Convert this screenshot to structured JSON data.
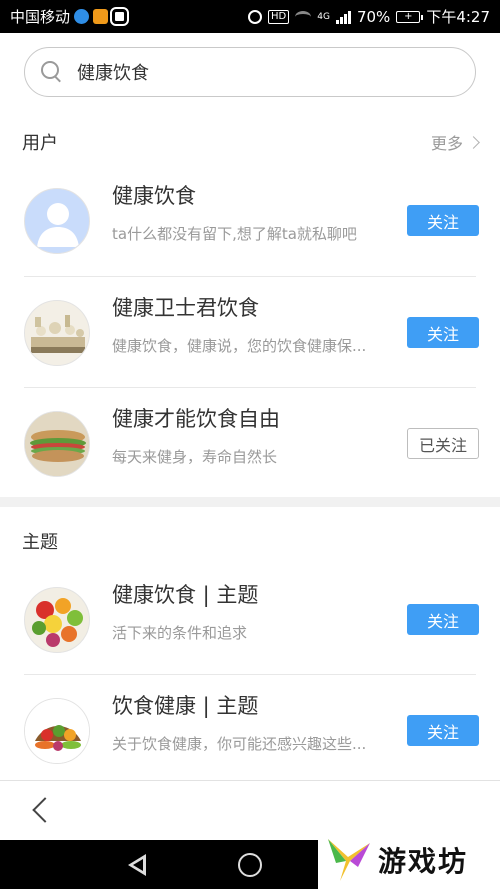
{
  "status_bar": {
    "carrier": "中国移动",
    "network": "4G",
    "hd_badge": "HD",
    "battery_percent": "70%",
    "time": "下午4:27"
  },
  "search": {
    "query": "健康饮食"
  },
  "users_section": {
    "title": "用户",
    "more_label": "更多",
    "items": [
      {
        "name": "健康饮食",
        "bio": "ta什么都没有留下,想了解ta就私聊吧",
        "button": "关注",
        "followed": false,
        "avatar": "default-avatar"
      },
      {
        "name": "健康卫士君饮食",
        "bio": "健康饮食，健康说，您的饮食健康保...",
        "button": "关注",
        "followed": false,
        "avatar": "food-photo-avatar"
      },
      {
        "name": "健康才能饮食自由",
        "bio": "每天来健身，寿命自然长",
        "button": "已关注",
        "followed": true,
        "avatar": "sandwich-avatar"
      }
    ]
  },
  "topics_section": {
    "title": "主题",
    "items": [
      {
        "name": "健康饮食 | 主题",
        "desc": "活下来的条件和追求",
        "button": "关注",
        "avatar": "fruits-avatar"
      },
      {
        "name": "饮食健康 | 主题",
        "desc": "关于饮食健康，你可能还感兴趣这些...",
        "button": "关注",
        "avatar": "vegetables-avatar"
      }
    ]
  },
  "watermark": {
    "brand": "游戏坊"
  },
  "colors": {
    "accent": "#3f9ef5",
    "text_primary": "#333333",
    "text_secondary": "#9a9a9a"
  }
}
